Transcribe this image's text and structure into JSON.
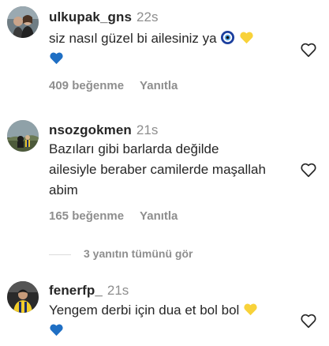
{
  "comments": [
    {
      "username": "ulkupak_gns",
      "time": "22s",
      "text": "siz nasıl güzel bi ailesiniz ya",
      "emojis": [
        "nazar-amulet-emoji",
        "yellow-heart-emoji",
        "blue-heart-emoji"
      ],
      "likes": "409 beğenme",
      "reply": "Yanıtla"
    },
    {
      "username": "nsozgokmen",
      "time": "21s",
      "text_lines": [
        "Bazıları gibi barlarda değilde",
        "ailesiyle beraber camilerde maşallah",
        "abim"
      ],
      "likes": "165 beğenme",
      "reply": "Yanıtla",
      "view_replies": "3 yanıtın tümünü gör"
    },
    {
      "username": "fenerfp_",
      "time": "21s",
      "text": "Yengem derbi için dua et bol bol",
      "emojis": [
        "yellow-heart-emoji",
        "blue-heart-emoji"
      ]
    }
  ],
  "colors": {
    "text": "#262626",
    "secondary": "#8e8e8e",
    "yellow_heart": "#f8d23a",
    "blue_heart": "#1f6fc4"
  },
  "icons": [
    "heart-outline-icon"
  ]
}
